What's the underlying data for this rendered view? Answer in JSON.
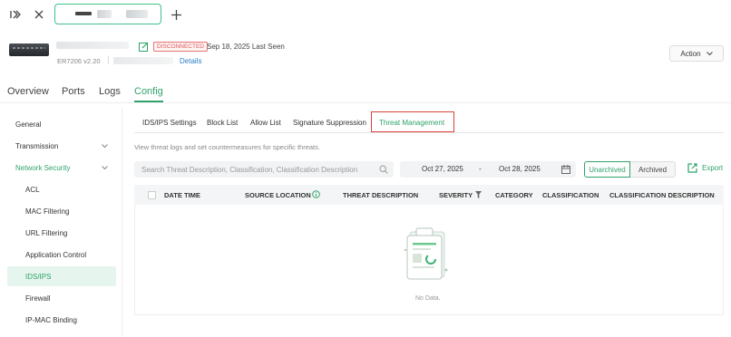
{
  "topbar": {
    "sidebar_toggle_icon": "sidebar-toggle-icon",
    "close_icon": "close-icon",
    "add_icon": "plus-icon"
  },
  "device": {
    "status": "DISCONNECTED",
    "last_seen": "Sep 18, 2025 Last Seen",
    "model": "ER7206 v2.20",
    "details_link": "Details",
    "action_button": "Action"
  },
  "main_tabs": [
    "Overview",
    "Ports",
    "Logs",
    "Config"
  ],
  "sidebar": {
    "items": [
      {
        "label": "General"
      },
      {
        "label": "Transmission"
      },
      {
        "label": "Network Security"
      },
      {
        "label": "ACL"
      },
      {
        "label": "MAC Filtering"
      },
      {
        "label": "URL Filtering"
      },
      {
        "label": "Application Control"
      },
      {
        "label": "IDS/IPS"
      },
      {
        "label": "Firewall"
      },
      {
        "label": "IP-MAC Binding"
      }
    ]
  },
  "sub_tabs": [
    "IDS/IPS Settings",
    "Block List",
    "Allow List",
    "Signature Suppression",
    "Threat Management"
  ],
  "description": "View threat logs and set countermeasures for specific threats.",
  "search": {
    "placeholder": "Search Threat Description, Classification, Classification Description"
  },
  "date_range": {
    "start": "Oct 27, 2025",
    "separator": "-",
    "end": "Oct 28, 2025"
  },
  "segment": {
    "unarchived": "Unarchived",
    "archived": "Archived"
  },
  "export_label": "Export",
  "table": {
    "columns": [
      "DATE TIME",
      "SOURCE LOCATION",
      "THREAT DESCRIPTION",
      "SEVERITY",
      "CATEGORY",
      "CLASSIFICATION",
      "CLASSIFICATION DESCRIPTION"
    ],
    "rows": [],
    "empty_text": "No Data."
  },
  "colors": {
    "accent": "#2fa36b",
    "status_red": "#e05555",
    "highlight_red": "#d9403a"
  }
}
